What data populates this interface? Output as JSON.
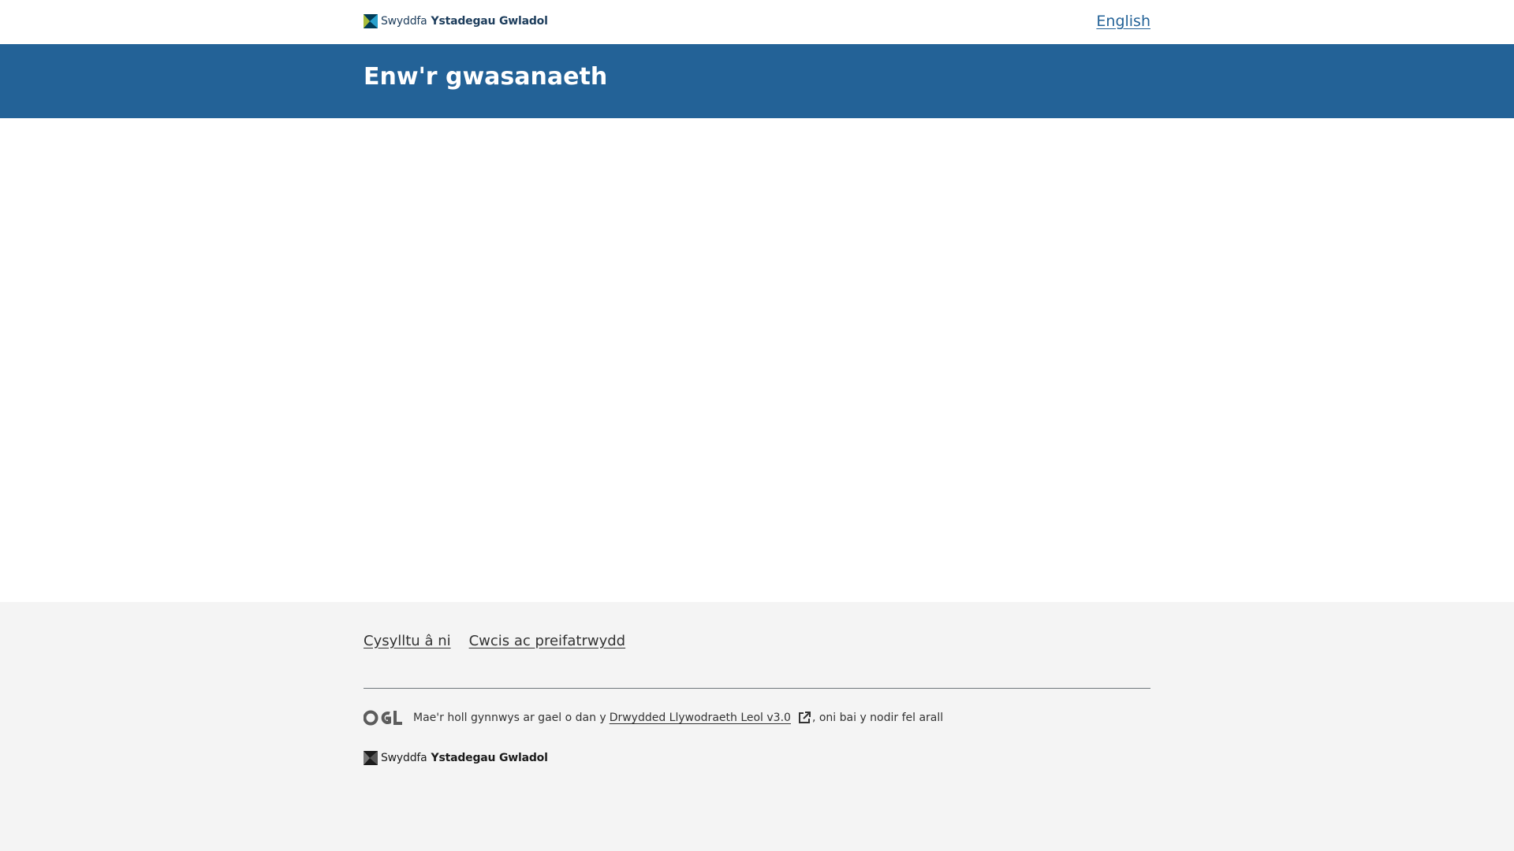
{
  "top_bar": {
    "brand_light": "Swyddfa",
    "brand_bold": "Ystadegau Gwladol",
    "language_link": "English"
  },
  "header": {
    "service_name": "Enw'r gwasanaeth"
  },
  "footer": {
    "links": [
      "Cysylltu â ni",
      "Cwcis ac preifatrwydd"
    ],
    "license_prefix": "Mae'r holl gynnwys ar gael o dan y",
    "license_link": "Drwydded Llywodraeth Leol v3.0",
    "license_suffix": ", oni bai y nodir fel arall",
    "ogl_logo_text": "OGL",
    "brand_light": "Swyddfa",
    "brand_bold": "Ystadegau Gwladol"
  },
  "colors": {
    "header_blue": "#236297",
    "footer_bg": "#f4f4f4",
    "brand_navy": "#1d3d5c",
    "brand_green": "#a8bd3a"
  },
  "icons": {
    "brand_logo": "ons-logo-icon",
    "ogl_logo": "ogl-logo-icon",
    "external_link": "external-link-icon"
  }
}
